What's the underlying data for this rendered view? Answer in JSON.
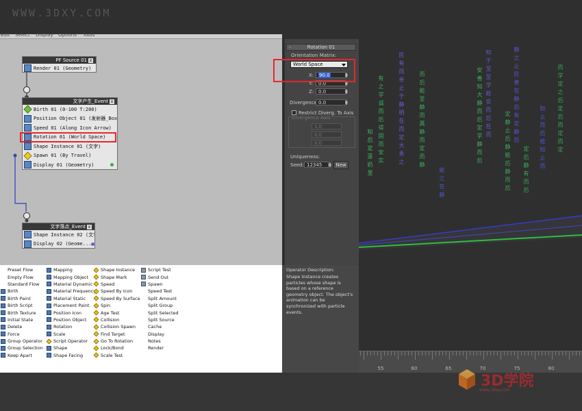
{
  "watermark": "WWW.3DXY.COM",
  "menubar": [
    "Edit",
    "Select",
    "Display",
    "Options",
    "Tools"
  ],
  "nodes": {
    "source": {
      "title": "PF Source 01",
      "rows": [
        "Render 01 (Geometry)"
      ]
    },
    "event1": {
      "title": "文字产生_Event",
      "rows": [
        "Birth 01 (0-100 T:200)",
        "Position Object 01 (发射器_Box)",
        "Speed 01 (Along Icon Arrow)",
        "Rotation 01 (World Space)",
        "Shape Instance 01 (文字)",
        "Spawn 01 (By Travel)",
        "Display 01 (Geometry)"
      ]
    },
    "event2": {
      "title": "文字落点_Event",
      "rows": [
        "Shape Instance 02 (文字)",
        "Display 02 (Geome..."
      ]
    }
  },
  "rollout": {
    "title": "Rotation 01",
    "orientation_label": "Orientation Matrix:",
    "orientation_value": "World Space",
    "x_label": "X:",
    "x_value": "90.0",
    "y_label": "Y:",
    "y_value": "0.0",
    "z_label": "Z:",
    "z_value": "0.0",
    "divergence_label": "Divergence:",
    "divergence_value": "0.0",
    "restrict_label": "Restrict Diverg. To Axis",
    "divergence_axis_label": "Divergence Axis",
    "dx_value": "1.0",
    "dy_value": "0.0",
    "dz_value": "0.0",
    "uniqueness_label": "Uniqueness:",
    "seed_label": "Seed:",
    "seed_value": "12345",
    "new_label": "New"
  },
  "depot": {
    "col1": [
      {
        "label": "Preset Flow",
        "icon": "none"
      },
      {
        "label": "Empty Flow",
        "icon": "none"
      },
      {
        "label": "Standard Flow",
        "icon": "none"
      },
      {
        "label": "Birth",
        "icon": "blue"
      },
      {
        "label": "Birth Paint",
        "icon": "blue"
      },
      {
        "label": "Birth Script",
        "icon": "blue"
      },
      {
        "label": "Birth Texture",
        "icon": "blue"
      },
      {
        "label": "Initial State",
        "icon": "blue"
      },
      {
        "label": "Delete",
        "icon": "blue"
      },
      {
        "label": "Force",
        "icon": "blue"
      },
      {
        "label": "Group Operator",
        "icon": "blue"
      },
      {
        "label": "Group Selection",
        "icon": "blue"
      },
      {
        "label": "Keep Apart",
        "icon": "blue"
      }
    ],
    "col2": [
      {
        "label": "Mapping",
        "icon": "blue"
      },
      {
        "label": "Mapping Object",
        "icon": "blue"
      },
      {
        "label": "Material Dynamic",
        "icon": "blue"
      },
      {
        "label": "Material Frequency",
        "icon": "blue"
      },
      {
        "label": "Material Static",
        "icon": "blue"
      },
      {
        "label": "Placement Paint",
        "icon": "blue"
      },
      {
        "label": "Position Icon",
        "icon": "blue"
      },
      {
        "label": "Position Object",
        "icon": "blue"
      },
      {
        "label": "Rotation",
        "icon": "blue"
      },
      {
        "label": "Scale",
        "icon": "blue"
      },
      {
        "label": "Script Operator",
        "icon": "yel"
      },
      {
        "label": "Shape",
        "icon": "blue"
      },
      {
        "label": "Shape Facing",
        "icon": "blue"
      }
    ],
    "col3": [
      {
        "label": "Shape Instance",
        "icon": "yel"
      },
      {
        "label": "Shape Mark",
        "icon": "yel"
      },
      {
        "label": "Speed",
        "icon": "yel"
      },
      {
        "label": "Speed By Icon",
        "icon": "yel"
      },
      {
        "label": "Speed By Surface",
        "icon": "yel"
      },
      {
        "label": "Spin",
        "icon": "yel"
      },
      {
        "label": "Age Test",
        "icon": "yel"
      },
      {
        "label": "Collision",
        "icon": "yel"
      },
      {
        "label": "Collision Spawn",
        "icon": "yel"
      },
      {
        "label": "Find Target",
        "icon": "yel"
      },
      {
        "label": "Go To Rotation",
        "icon": "yel"
      },
      {
        "label": "Lock/Bond",
        "icon": "yel"
      },
      {
        "label": "Scale Test",
        "icon": "yel"
      }
    ],
    "col4": [
      {
        "label": "Script Test",
        "icon": "gray"
      },
      {
        "label": "Send Out",
        "icon": "gray"
      },
      {
        "label": "Spawn",
        "icon": "gray"
      },
      {
        "label": "Speed Test",
        "icon": "none"
      },
      {
        "label": "Split Amount",
        "icon": "none"
      },
      {
        "label": "Split Group",
        "icon": "none"
      },
      {
        "label": "Split Selected",
        "icon": "none"
      },
      {
        "label": "Split Source",
        "icon": "none"
      },
      {
        "label": "Cache",
        "icon": "none"
      },
      {
        "label": "Display",
        "icon": "none"
      },
      {
        "label": "Notes",
        "icon": "none"
      },
      {
        "label": "Render",
        "icon": "none"
      }
    ]
  },
  "description": {
    "title": "Operator Description:",
    "text": "Shape Instance creates particles whose shape is based on a reference geometry object. The object's animation can be synchronized with particle events."
  },
  "viewport_columns": [
    {
      "chars": "知后定莲奶里",
      "color": "#3dbb5a"
    },
    {
      "chars": "有之学诚而后得固而安实",
      "color": "#35b25a"
    },
    {
      "chars": "民有而亲止于静明在而定大贵之",
      "color": "#6a5ad8"
    },
    {
      "chars": "而后能至静而属静而定而静",
      "color": "#3aae55"
    },
    {
      "chars": "能之在静",
      "color": "#4d55d0"
    },
    {
      "chars": "安善知大静而后定学静而后",
      "color": "#3caf58"
    },
    {
      "chars": "知于至至学能安而后在而",
      "color": "#5d58d5"
    },
    {
      "chars": "定静止后静能后静而后",
      "color": "#3aaa55"
    },
    {
      "chars": "静之止民善在静后有定静后",
      "color": "#5852cf"
    },
    {
      "chars": "定后静有而后",
      "color": "#3aaa55"
    },
    {
      "chars": "知止而后能知止而",
      "color": "#4f55d2"
    },
    {
      "chars": "而学定之后定后而定而定",
      "color": "#35a850"
    }
  ],
  "timeline_labels": [
    "55",
    "60",
    "65",
    "70",
    "75",
    "80"
  ],
  "logo": {
    "text": "3D学院",
    "sub": "www.3dxy.com"
  }
}
